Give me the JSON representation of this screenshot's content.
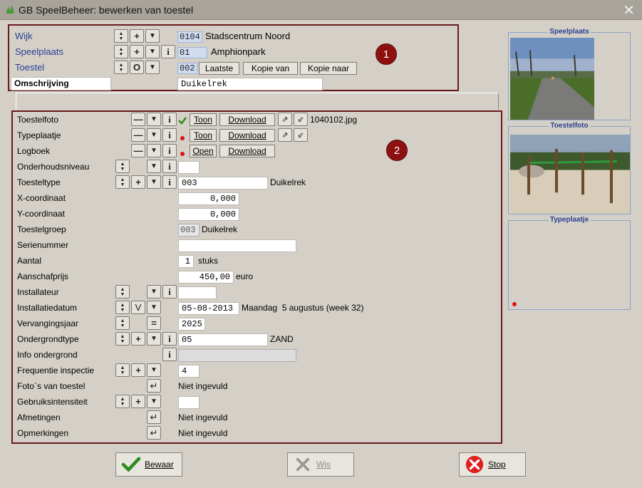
{
  "window": {
    "title": "GB SpeelBeheer: bewerken van toestel"
  },
  "top": {
    "wijk_label": "Wijk",
    "wijk_code": "0104",
    "wijk_name": "Stadscentrum Noord",
    "speelplaats_label": "Speelplaats",
    "speelplaats_code": "01",
    "speelplaats_name": "Amphionpark",
    "toestel_label": "Toestel",
    "toestel_code": "002",
    "btn_laatste": "Laatste",
    "btn_kopie_van": "Kopie van",
    "btn_kopie_naar": "Kopie naar",
    "omschrijving_label": "Omschrijving",
    "omschrijving_value": "Duikelrek",
    "badge": "1"
  },
  "main": {
    "badge": "2",
    "rows": {
      "toestelfoto": {
        "label": "Toestelfoto",
        "toon": "Toon",
        "download": "Download",
        "file": "1040102.jpg"
      },
      "typeplaatje": {
        "label": "Typeplaatje",
        "toon": "Toon",
        "download": "Download"
      },
      "logboek": {
        "label": "Logboek",
        "open": "Open",
        "download": "Download"
      },
      "onderhoudsniveau": {
        "label": "Onderhoudsniveau",
        "value": ""
      },
      "toesteltype": {
        "label": "Toesteltype",
        "value": "003",
        "name": "Duikelrek"
      },
      "xcoord": {
        "label": "X-coordinaat",
        "value": "0,000"
      },
      "ycoord": {
        "label": "Y-coordinaat",
        "value": "0,000"
      },
      "toestelgroep": {
        "label": "Toestelgroep",
        "code": "003",
        "name": "Duikelrek"
      },
      "serienummer": {
        "label": "Serienummer",
        "value": ""
      },
      "aantal": {
        "label": "Aantal",
        "value": "1",
        "unit": "stuks"
      },
      "aanschafprijs": {
        "label": "Aanschafprijs",
        "value": "450,00",
        "unit": "euro"
      },
      "installateur": {
        "label": "Installateur",
        "value": ""
      },
      "installatiedatum": {
        "label": "Installatiedatum",
        "value": "05-08-2013",
        "text": "Maandag  5 augustus (week 32)",
        "v_button": "V"
      },
      "vervangingsjaar": {
        "label": "Vervangingsjaar",
        "value": "2025",
        "eq_button": "="
      },
      "ondergrondtype": {
        "label": "Ondergrondtype",
        "value": "05",
        "name": "ZAND"
      },
      "info_ondergrond": {
        "label": "Info ondergrond",
        "value": ""
      },
      "frequentie": {
        "label": "Frequentie inspectie",
        "value": "4"
      },
      "fotos": {
        "label": "Foto`s van toestel",
        "value": "Niet ingevuld"
      },
      "gebruiksintensiteit": {
        "label": "Gebruiksintensiteit",
        "value": ""
      },
      "afmetingen": {
        "label": "Afmetingen",
        "value": "Niet ingevuld"
      },
      "opmerkingen": {
        "label": "Opmerkingen",
        "value": "Niet ingevuld"
      }
    }
  },
  "side": {
    "speelplaats_title": "Speelplaats",
    "toestelfoto_title": "Toestelfoto",
    "typeplaatje_title": "Typeplaatje"
  },
  "footer": {
    "bewaar": "Bewaar",
    "wis": "Wis",
    "stop": "Stop"
  },
  "colors": {
    "frame": "#6b1a1a",
    "label_blue": "#2b3e8f",
    "badge": "#8e1111",
    "ok_green": "#2e8b1e",
    "stop_red": "#e02020"
  }
}
